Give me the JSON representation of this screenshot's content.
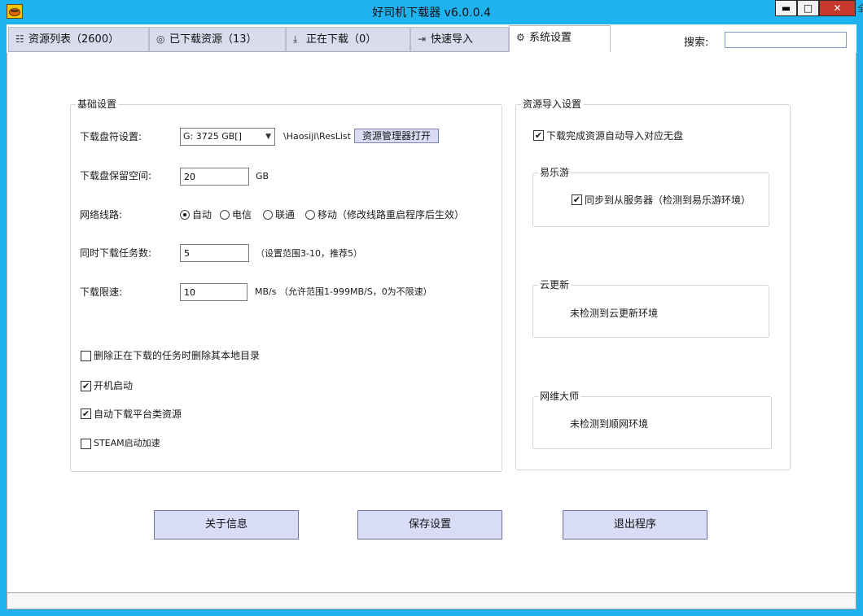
{
  "window": {
    "title": "好司机下载器 v6.0.0.4",
    "min_glyph": "▬",
    "max_glyph": "□",
    "close_glyph": "✕",
    "edge_glyph": "全"
  },
  "tabs": [
    {
      "icon": "list-icon",
      "glyph": "☷",
      "label": "资源列表（2600）"
    },
    {
      "icon": "check-circle-icon",
      "glyph": "◎",
      "label": "已下载资源（13）"
    },
    {
      "icon": "download-icon",
      "glyph": "⤓",
      "label": "正在下载（0）"
    },
    {
      "icon": "import-icon",
      "glyph": "⇥",
      "label": "快速导入"
    },
    {
      "icon": "gear-icon",
      "glyph": "⚙",
      "label": "系统设置"
    }
  ],
  "search": {
    "label": "搜索:",
    "value": ""
  },
  "basic": {
    "title": "基础设置",
    "drive_label": "下载盘符设置:",
    "drive_value": "G: 3725 GB[]",
    "drive_path": "\\Haosiji\\ResList",
    "open_explorer": "资源管理器打开",
    "reserve_label": "下载盘保留空间:",
    "reserve_value": "20",
    "reserve_unit": "GB",
    "network_label": "网络线路:",
    "network_options": [
      "自动",
      "电信",
      "联通",
      "移动（修改线路重启程序后生效）"
    ],
    "network_selected": "自动",
    "tasks_label": "同时下载任务数:",
    "tasks_value": "5",
    "tasks_hint": "（设置范围3-10，推荐5）",
    "speed_label": "下载限速:",
    "speed_value": "10",
    "speed_unit": "MB/s",
    "speed_hint": "（允许范围1-999MB/S，0为不限速）",
    "checkboxes": [
      {
        "label": "删除正在下载的任务时删除其本地目录",
        "checked": false
      },
      {
        "label": "开机启动",
        "checked": true
      },
      {
        "label": "自动下载平台类资源",
        "checked": true
      },
      {
        "label": "STEAM启动加速",
        "checked": false
      }
    ]
  },
  "import": {
    "title": "资源导入设置",
    "auto_import": {
      "label": "下载完成资源自动导入对应无盘",
      "checked": true
    },
    "yiley": {
      "title": "易乐游",
      "sync_label": "同步到从服务器（检测到易乐游环境）",
      "checked": true
    },
    "cloud": {
      "title": "云更新",
      "status": "未检测到云更新环境"
    },
    "wangwei": {
      "title": "网维大师",
      "status": "未检测到顺网环境"
    }
  },
  "buttons": {
    "about": "关于信息",
    "save": "保存设置",
    "exit": "退出程序"
  },
  "check_glyph": "✔"
}
